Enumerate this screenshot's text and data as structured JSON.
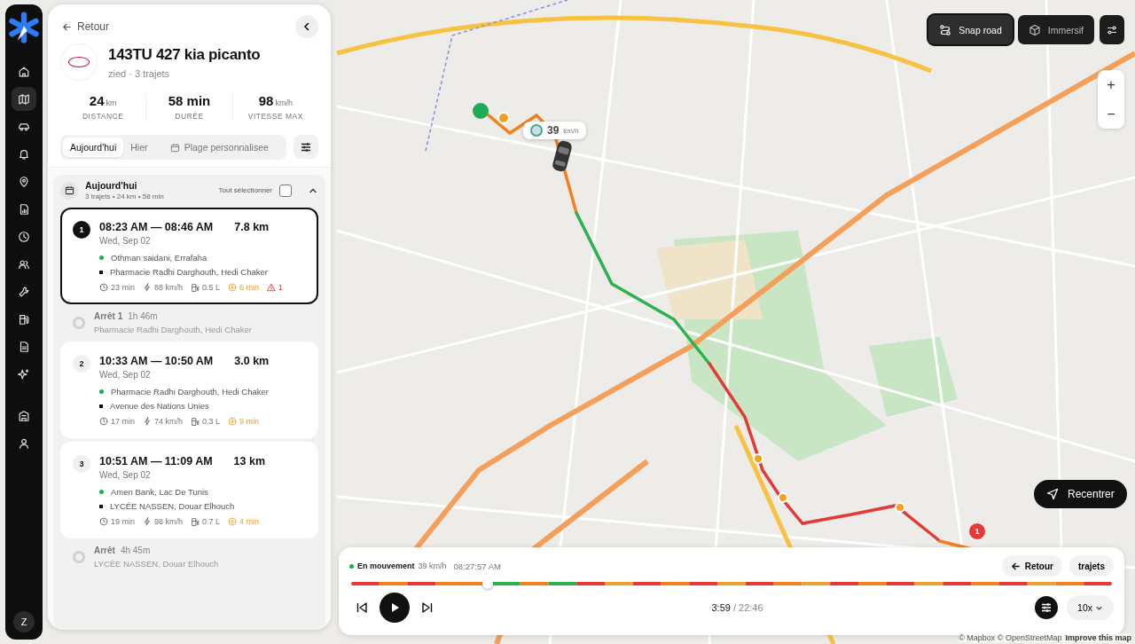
{
  "nav": {
    "items": [
      {
        "kind": "home",
        "selected": false
      },
      {
        "kind": "map",
        "selected": true
      },
      {
        "kind": "car",
        "selected": false
      },
      {
        "kind": "bell",
        "selected": false
      },
      {
        "kind": "pin",
        "selected": false
      },
      {
        "kind": "report",
        "selected": false
      },
      {
        "kind": "clock",
        "selected": false
      },
      {
        "kind": "users",
        "selected": false
      },
      {
        "kind": "wrench",
        "selected": false
      },
      {
        "kind": "fuel",
        "selected": false
      },
      {
        "kind": "document",
        "selected": false
      },
      {
        "kind": "sparkle",
        "selected": false
      },
      {
        "kind": "building",
        "selected": false
      },
      {
        "kind": "user",
        "selected": false
      }
    ],
    "avatar": "Z"
  },
  "panel": {
    "back": "Retour",
    "vehicle": {
      "title": "143TU 427 kia picanto",
      "subtitle": "zied · 3 trajets"
    },
    "stats": [
      {
        "value": "24",
        "unit": "km",
        "label": "DISTANCE"
      },
      {
        "value": "58 min",
        "label": "DURÉE"
      },
      {
        "value": "98",
        "unit": "km/h",
        "label": "VITESSE MAX"
      }
    ],
    "date_tabs": [
      {
        "label": "Aujourd'hui",
        "selected": true,
        "kind": "plain"
      },
      {
        "label": "Hier",
        "selected": false,
        "kind": "plain"
      },
      {
        "label": "Plage personnalisee",
        "selected": false,
        "kind": "calendar"
      }
    ],
    "day": {
      "title": "Aujourd'hui",
      "summary": "3 trajets • 24 km • 58 min",
      "select_all": "Tout sélectionner",
      "checked": false,
      "expanded": true
    },
    "timeline": [
      {
        "kind": "trip",
        "number": "1",
        "selected": true,
        "times": "08:23 AM — 08:46 AM",
        "distance": "7.8 km",
        "date": "Wed, Sep 02",
        "start": "Othman saidani, Errafaha",
        "end": "Pharmacie Radhi Darghouth, Hedi Chaker",
        "duration": "23 min",
        "max_speed": "88 km/h",
        "fuel": "0.5 L",
        "idle": "6 min",
        "alerts": "1"
      },
      {
        "kind": "stop",
        "title": "Arrêt 1",
        "duration": "1h 46m",
        "place": "Pharmacie Radhi Darghouth, Hedi Chaker"
      },
      {
        "kind": "trip",
        "number": "2",
        "selected": false,
        "times": "10:33 AM — 10:50 AM",
        "distance": "3.0 km",
        "date": "Wed, Sep 02",
        "start": "Pharmacie Radhi Darghouth, Hedi Chaker",
        "end": "Avenue des Nations Unies",
        "duration": "17 min",
        "max_speed": "74 km/h",
        "fuel": "0.3 L",
        "idle": "9 min"
      },
      {
        "kind": "trip",
        "number": "3",
        "selected": false,
        "times": "10:51 AM — 11:09 AM",
        "distance": "13 km",
        "date": "Wed, Sep 02",
        "start": "Amen Bank, Lac De Tunis",
        "end": "LYCÉE NASSEN, Douar Elhouch",
        "duration": "19 min",
        "max_speed": "98 km/h",
        "fuel": "0.7 L",
        "idle": "4 min"
      },
      {
        "kind": "stop",
        "title": "Arrêt",
        "duration": "4h 45m",
        "place": "LYCÉE NASSEN, Douar Elhouch"
      }
    ]
  },
  "map": {
    "toggles": [
      {
        "label": "Snap road",
        "kind": "snap",
        "selected": true
      },
      {
        "label": "Immersif",
        "kind": "cube",
        "selected": false
      }
    ],
    "zoom_in": "+",
    "zoom_out": "−",
    "speed_bubble": {
      "value": "39",
      "unit": "km/h"
    },
    "marker": "1",
    "recenter": "Recentrer",
    "attribution": {
      "text": "© Mapbox © OpenStreetMap",
      "link": "Improve this map"
    }
  },
  "player": {
    "status": "En mouvement",
    "speed": "39 km/h",
    "clock": "08:27:57 AM",
    "back": "Retour",
    "trips": "trajets",
    "level": 0.18,
    "elapsed": "3:59",
    "total": "/ 22:46",
    "rate": "10x"
  }
}
